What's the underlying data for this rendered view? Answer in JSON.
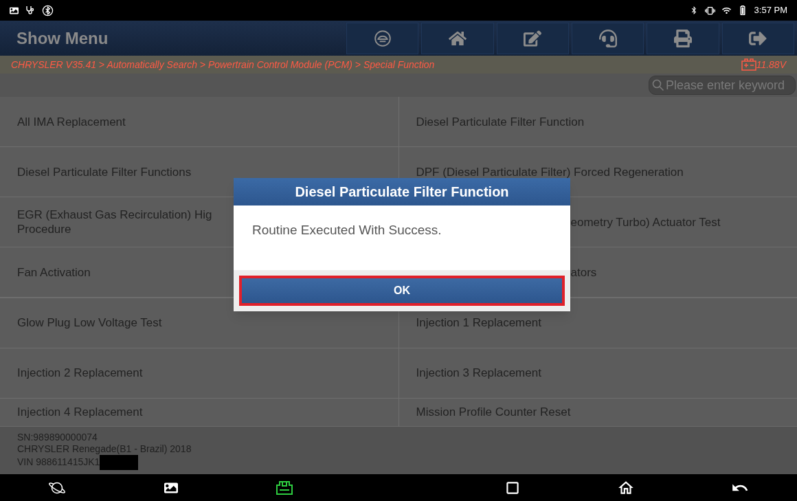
{
  "status_bar": {
    "time": "3:57 PM"
  },
  "header": {
    "title": "Show Menu",
    "toolbar": [
      {
        "kind": "car"
      },
      {
        "kind": "home"
      },
      {
        "kind": "edit"
      },
      {
        "kind": "support"
      },
      {
        "kind": "print"
      },
      {
        "kind": "exit"
      }
    ]
  },
  "breadcrumb": {
    "path": "CHRYSLER V35.41 > Automatically Search > Powertrain Control Module (PCM) > Special Function",
    "voltage": "11.88V"
  },
  "search": {
    "placeholder": "Please enter keyword"
  },
  "menu_items": [
    {
      "lines": [
        "All IMA Replacement"
      ],
      "kind": "plain"
    },
    {
      "lines": [
        "Diesel Particulate Filter Function"
      ],
      "kind": "plain"
    },
    {
      "lines": [
        "Diesel Particulate Filter Functions"
      ],
      "kind": "plain"
    },
    {
      "lines": [
        "DPF (Diesel Particulate Filter) Forced Regeneration"
      ],
      "kind": "plain"
    },
    {
      "lines": [
        "EGR (Exhaust Gas Recirculation) Hig",
        "Procedure"
      ],
      "kind": "plain"
    },
    {
      "lines": [
        "eometry Turbo) Actuator Test"
      ],
      "kind": "covered"
    },
    {
      "lines": [
        "Fan Activation"
      ],
      "kind": "plain"
    },
    {
      "lines": [
        "ators"
      ],
      "kind": "covered"
    },
    {
      "lines": [
        "Glow Plug Low Voltage Test"
      ],
      "kind": "plain"
    },
    {
      "lines": [
        "Injection 1 Replacement"
      ],
      "kind": "plain"
    },
    {
      "lines": [
        "Injection 2 Replacement"
      ],
      "kind": "plain"
    },
    {
      "lines": [
        "Injection 3 Replacement"
      ],
      "kind": "plain"
    },
    {
      "lines": [
        "Injection 4 Replacement"
      ],
      "kind": "plain"
    },
    {
      "lines": [
        "Mission Profile Counter Reset"
      ],
      "kind": "plain"
    }
  ],
  "vehicle_info": {
    "sn": "SN:989890000074",
    "model": "CHRYSLER Renegade(B1 - Brazil) 2018",
    "vin": "VIN 988611415JK1"
  },
  "dialog": {
    "title": "Diesel Particulate Filter Function",
    "message": "Routine Executed With Success.",
    "button": "OK",
    "button_highlighted": true
  },
  "nav_bar": [
    {
      "kind": "browser"
    },
    {
      "kind": "gallery"
    },
    {
      "kind": "vci"
    },
    {
      "kind": "spacer"
    },
    {
      "kind": "recents"
    },
    {
      "kind": "home"
    },
    {
      "kind": "back"
    }
  ]
}
